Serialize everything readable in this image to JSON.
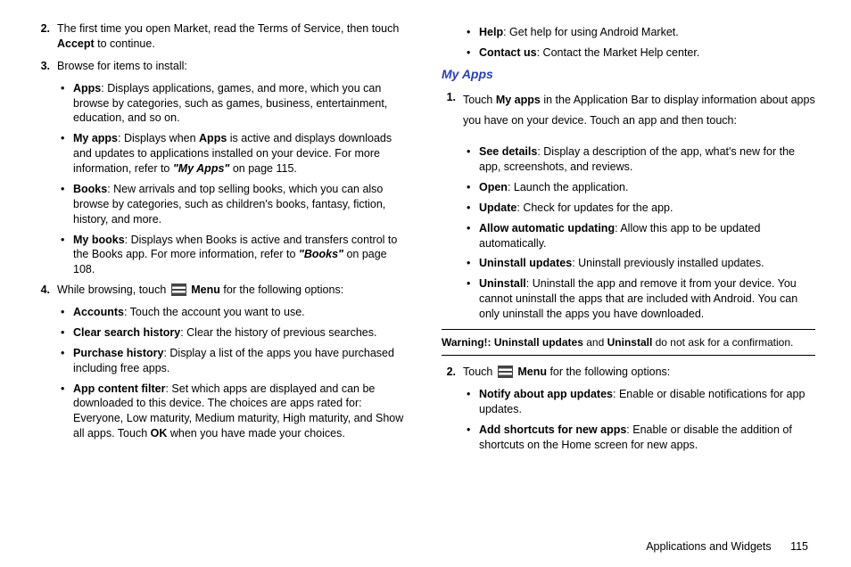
{
  "left": {
    "step2": {
      "num": "2.",
      "text_a": "The first time you open Market, read the Terms of Service, then touch ",
      "accept": "Accept",
      "text_b": " to continue."
    },
    "step3": {
      "num": "3.",
      "text": "Browse for items to install:"
    },
    "b_apps": {
      "label": "Apps",
      "text": ": Displays applications, games, and more, which you can browse by categories, such as games, business, entertainment, education, and so on."
    },
    "b_myapps": {
      "label": "My apps",
      "text_a": ": Displays when ",
      "apps_bold": "Apps",
      "text_b": " is active and displays downloads and updates to applications installed on your device. For more information, refer to ",
      "ref": "\"My Apps\"",
      "text_c": "  on page 115."
    },
    "b_books": {
      "label": "Books",
      "text": ": New arrivals and top selling books, which you can also browse by categories, such as children's books, fantasy, fiction, history, and more."
    },
    "b_mybooks": {
      "label": "My books",
      "text_a": ": Displays when Books is active and transfers control to the Books app. For more information, refer to ",
      "ref": "\"Books\"",
      "text_b": "  on page 108."
    },
    "step4": {
      "num": "4.",
      "text_a": "While browsing, touch ",
      "menu": "Menu",
      "text_b": " for the following options:"
    },
    "b_accounts": {
      "label": "Accounts",
      "text": ": Touch the account you want to use."
    },
    "b_clear": {
      "label": "Clear search history",
      "text": ": Clear the history of previous searches."
    },
    "b_purchase": {
      "label": "Purchase history",
      "text": ": Display a list of the apps you have purchased including free apps."
    },
    "b_filter": {
      "label": "App content filter",
      "text_a": ": Set which apps are displayed and can be downloaded to this device. The choices are apps rated for: Everyone, Low maturity, Medium maturity, High maturity, and Show all apps. Touch ",
      "ok": "OK",
      "text_b": " when you have made your choices."
    }
  },
  "right": {
    "b_help": {
      "label": "Help",
      "text": ": Get help for using Android Market."
    },
    "b_contact": {
      "label": "Contact us",
      "text": ": Contact the Market Help center."
    },
    "heading": "My Apps",
    "step1": {
      "num": "1.",
      "text_a": "Touch ",
      "myapps": "My apps",
      "text_b": " in the Application Bar to display information about apps you have on your device. Touch an app and then touch:"
    },
    "b_see": {
      "label": "See details",
      "text": ": Display a description of the app, what's new for the app, screenshots, and reviews."
    },
    "b_open": {
      "label": "Open",
      "text": ": Launch the application."
    },
    "b_update": {
      "label": "Update",
      "text": ": Check for updates for the app."
    },
    "b_allow": {
      "label": "Allow automatic updating",
      "text": ": Allow this app to be updated automatically."
    },
    "b_unupd": {
      "label": "Uninstall updates",
      "text": ": Uninstall previously installed updates."
    },
    "b_uninst": {
      "label": "Uninstall",
      "text": ": Uninstall the app and remove it from your device. You cannot uninstall the apps that are included with Android. You can only uninstall the apps you have downloaded."
    },
    "warning": {
      "label": "Warning!:",
      "u1": "Uninstall updates",
      "mid": " and ",
      "u2": "Uninstall",
      "tail": " do not ask for a confirmation."
    },
    "step2": {
      "num": "2.",
      "text_a": "Touch ",
      "menu": "Menu",
      "text_b": " for the following options:"
    },
    "b_notify": {
      "label": "Notify about app updates",
      "text": ": Enable or disable notifications for app updates."
    },
    "b_short": {
      "label": "Add shortcuts for new apps",
      "text": ": Enable or disable the addition of shortcuts on the Home screen for new apps."
    }
  },
  "footer": {
    "section": "Applications and Widgets",
    "page": "115"
  }
}
